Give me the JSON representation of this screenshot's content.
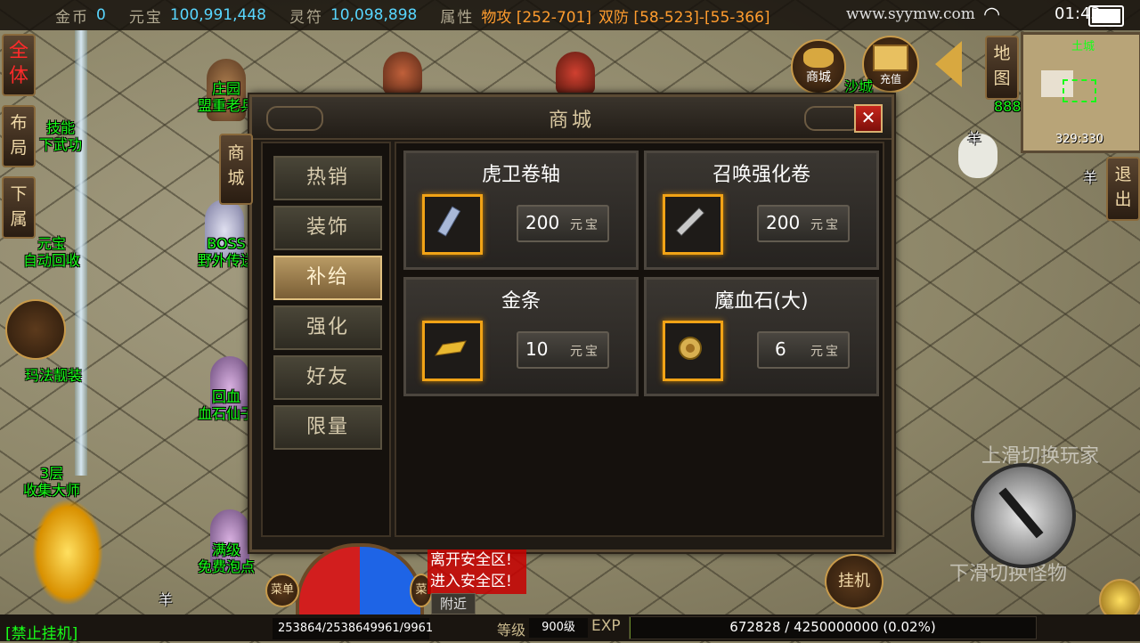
{
  "topbar": {
    "gold_label": "金币",
    "gold_value": "0",
    "yuanbao_label": "元宝",
    "yuanbao_value": "100,991,448",
    "talisman_label": "灵符",
    "talisman_value": "10,098,898",
    "attr_label": "属性",
    "attack": "物攻 [252-701]",
    "defense": "双防 [58-523]-[55-366]",
    "watermark": "www.syymw.com",
    "time": "01:43"
  },
  "left_panel": {
    "all_btn": "全体",
    "layout_btn": "布局",
    "subordinate_btn": "下属",
    "skill_label_1": "技能",
    "skill_label_2": "下武功",
    "yuanbao_recycle_1": "元宝",
    "yuanbao_recycle_2": "自动回收",
    "mafa_label": "玛法靓装",
    "collect_1": "3层",
    "collect_2": "收集大师"
  },
  "npcs": {
    "manor_1": "庄园",
    "manor_2": "盟重老兵",
    "boss_1": "BOSS",
    "boss_2": "野外传送",
    "heal_1": "回血",
    "heal_2": "血石仙子",
    "fullrank_1": "满级",
    "fullrank_2": "免费泡点",
    "sheep": "羊",
    "number": "888"
  },
  "shop": {
    "side_tab": "商城",
    "title": "商城",
    "close": "✕",
    "tabs": [
      "热销",
      "装饰",
      "补给",
      "强化",
      "好友",
      "限量"
    ],
    "active_tab": "补给",
    "items": [
      {
        "name": "虎卫卷轴",
        "price": "200",
        "currency": "元宝",
        "icon": "scroll-icon"
      },
      {
        "name": "召唤强化卷",
        "price": "200",
        "currency": "元宝",
        "icon": "summon-scroll-icon"
      },
      {
        "name": "金条",
        "price": "10",
        "currency": "元宝",
        "icon": "gold-bar-icon"
      },
      {
        "name": "魔血石(大)",
        "price": "6",
        "currency": "元宝",
        "icon": "blood-stone-icon"
      }
    ]
  },
  "top_right": {
    "shop_btn": "商城",
    "recharge_btn": "充值",
    "sabak": "沙城",
    "map_btn": "地图",
    "exit_btn": "退出",
    "minimap_name": "土城",
    "minimap_coord": "329:330"
  },
  "controls": {
    "swipe_up": "上滑切换玩家",
    "swipe_down": "下滑切换怪物",
    "hangup": "挂机",
    "menu": "菜单",
    "safe_leave": "离开安全区!",
    "safe_enter": "进入安全区!",
    "nearby": "附近"
  },
  "bottombar": {
    "stop_bot": "[禁止挂机]",
    "hp_mp": "253864/2538649961/9961",
    "level_label": "等级",
    "level_value": "900级",
    "exp_label": "EXP",
    "exp_text": "672828 / 4250000000 (0.02%)",
    "exp_fraction": 0.0002
  }
}
